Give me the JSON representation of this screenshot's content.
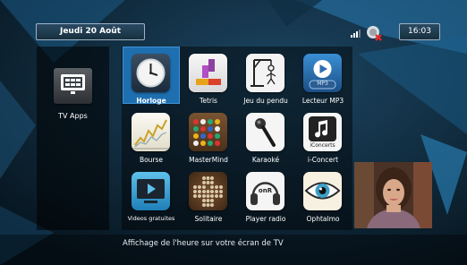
{
  "header": {
    "date": "Jeudi 20 Août",
    "time": "16:03"
  },
  "sidebar": {
    "label": "TV Apps",
    "icon": "tv-apps-grid-icon"
  },
  "apps": [
    {
      "label": "Horloge",
      "icon": "clock-icon",
      "selected": true
    },
    {
      "label": "Tetris",
      "icon": "tetris-blocks-icon"
    },
    {
      "label": "Jeu du pendu",
      "icon": "hangman-icon"
    },
    {
      "label": "Lecteur MP3",
      "icon": "mp3-player-icon"
    },
    {
      "label": "Bourse",
      "icon": "stock-chart-icon"
    },
    {
      "label": "MasterMind",
      "icon": "mastermind-board-icon"
    },
    {
      "label": "Karaoké",
      "icon": "microphone-icon"
    },
    {
      "label": "i-Concert",
      "icon": "iconcerts-icon",
      "icon_text": "iConcerts"
    },
    {
      "label": "Videos gratuites",
      "icon": "video-play-icon"
    },
    {
      "label": "Solitaire",
      "icon": "solitaire-board-icon"
    },
    {
      "label": "Player radio",
      "icon": "radio-headphones-icon",
      "icon_text": "onR"
    },
    {
      "label": "Ophtalmo",
      "icon": "eye-icon"
    }
  ],
  "mp3_icon_text": "MP3",
  "footer": {
    "description": "Affichage de l'heure sur votre écran de TV"
  },
  "colors": {
    "selection": "#1e6fb0",
    "background": "#0b1f2e"
  }
}
